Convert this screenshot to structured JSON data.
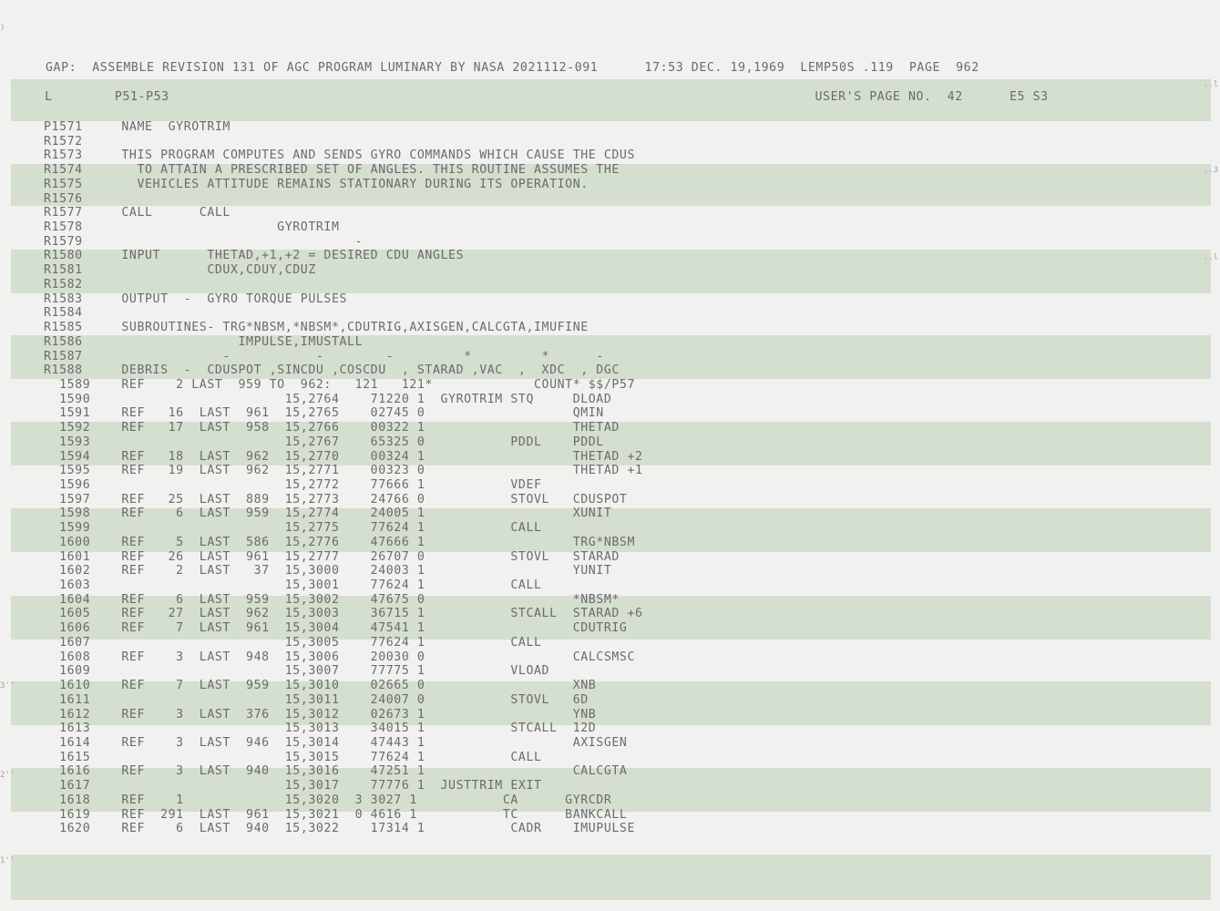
{
  "header": {
    "line1": "GAP:  ASSEMBLE REVISION 131 OF AGC PROGRAM LUMINARY BY NASA 2021112-091      17:53 DEC. 19,1969  LEMP50S .119  PAGE  962",
    "line2": "  L        P51-P53                                                                                   USER'S PAGE NO.  42      E5 S3"
  },
  "lines": [
    "P1571     NAME  GYROTRIM",
    "R1572",
    "R1573     THIS PROGRAM COMPUTES AND SENDS GYRO COMMANDS WHICH CAUSE THE CDUS",
    "R1574       TO ATTAIN A PRESCRIBED SET OF ANGLES. THIS ROUTINE ASSUMES THE",
    "R1575       VEHICLES ATTITUDE REMAINS STATIONARY DURING ITS OPERATION.",
    "R1576",
    "R1577     CALL      CALL",
    "R1578                         GYROTRIM",
    "R1579                                   -",
    "R1580     INPUT      THETAD,+1,+2 = DESIRED CDU ANGLES",
    "R1581                CDUX,CDUY,CDUZ",
    "R1582",
    "R1583     OUTPUT  -  GYRO TORQUE PULSES",
    "R1584",
    "R1585     SUBROUTINES- TRG*NBSM,*NBSM*,CDUTRIG,AXISGEN,CALCGTA,IMUFINE",
    "R1586                    IMPULSE,IMUSTALL",
    "R1587                  -           -        -         *         *      -",
    "R1588     DEBRIS  -  CDUSPOT ,SINCDU ,COSCDU  , STARAD ,VAC  ,  XDC  , DGC",
    "  1589    REF    2 LAST  959 TO  962:   121   121*             COUNT* $$/P57",
    "  1590                         15,2764    71220 1  GYROTRIM STQ     DLOAD",
    "  1591    REF   16  LAST  961  15,2765    02745 0                   QMIN",
    "  1592    REF   17  LAST  958  15,2766    00322 1                   THETAD",
    "  1593                         15,2767    65325 0           PDDL    PDDL",
    "  1594    REF   18  LAST  962  15,2770    00324 1                   THETAD +2",
    "  1595    REF   19  LAST  962  15,2771    00323 0                   THETAD +1",
    "  1596                         15,2772    77666 1           VDEF",
    "  1597    REF   25  LAST  889  15,2773    24766 0           STOVL   CDUSPOT",
    "  1598    REF    6  LAST  959  15,2774    24005 1                   XUNIT",
    "  1599                         15,2775    77624 1           CALL",
    "  1600    REF    5  LAST  586  15,2776    47666 1                   TRG*NBSM",
    "  1601    REF   26  LAST  961  15,2777    26707 0           STOVL   STARAD",
    "  1602    REF    2  LAST   37  15,3000    24003 1                   YUNIT",
    "  1603                         15,3001    77624 1           CALL",
    "  1604    REF    6  LAST  959  15,3002    47675 0                   *NBSM*",
    "  1605    REF   27  LAST  962  15,3003    36715 1           STCALL  STARAD +6",
    "  1606    REF    7  LAST  961  15,3004    47541 1                   CDUTRIG",
    "  1607                         15,3005    77624 1           CALL",
    "  1608    REF    3  LAST  948  15,3006    20030 0                   CALCSMSC",
    "  1609                         15,3007    77775 1           VLOAD",
    "  1610    REF    7  LAST  959  15,3010    02665 0                   XNB",
    "  1611                         15,3011    24007 0           STOVL   6D",
    "  1612    REF    3  LAST  376  15,3012    02673 1                   YNB",
    "  1613                         15,3013    34015 1           STCALL  12D",
    "  1614    REF    3  LAST  946  15,3014    47443 1                   AXISGEN",
    "  1615                         15,3015    77624 1           CALL",
    "  1616    REF    3  LAST  940  15,3016    47251 1                   CALCGTA",
    "  1617                         15,3017    77776 1  JUSTTRIM EXIT",
    "  1618    REF    1             15,3020  3 3027 1           CA      GYRCDR",
    "  1619    REF  291  LAST  961  15,3021  0 4616 1           TC      BANKCALL",
    "  1620    REF    6  LAST  940  15,3022    17314 1           CADR    IMUPULSE"
  ]
}
